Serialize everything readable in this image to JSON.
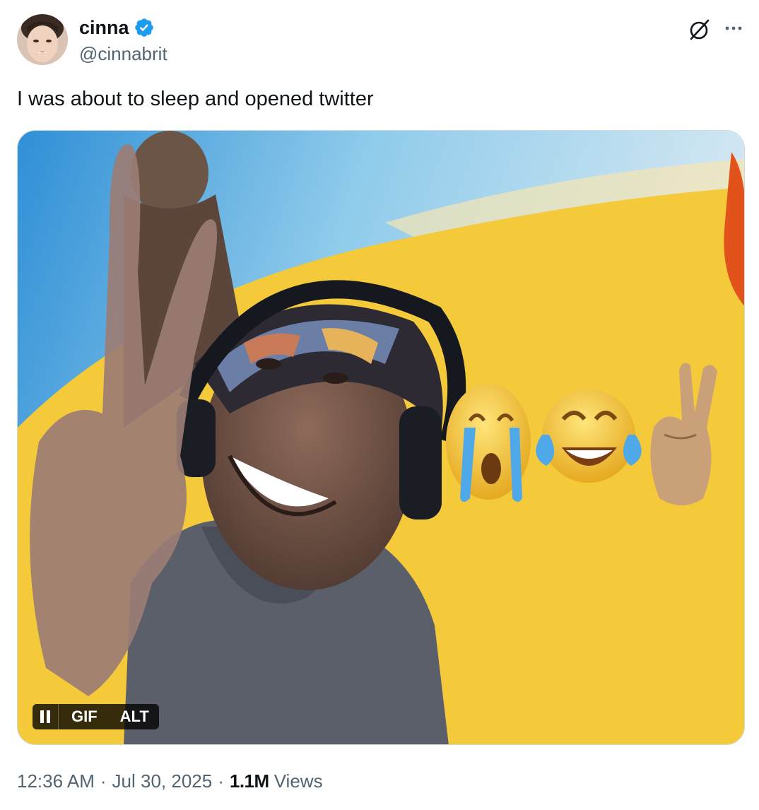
{
  "author": {
    "display_name": "cinna",
    "handle": "@cinnabrit",
    "verified": true
  },
  "icons": {
    "avatar": "avatar",
    "verified": "verified-badge-icon",
    "grok": "grok-icon",
    "more": "more-icon",
    "pause": "pause-icon"
  },
  "tweet": {
    "text": "I was about to sleep and opened twitter"
  },
  "media": {
    "type": "GIF",
    "gif_label": "GIF",
    "alt_label": "ALT"
  },
  "meta": {
    "time": "12:36 AM",
    "date": "Jul 30, 2025",
    "views_count": "1.1M",
    "views_label": "Views",
    "separator": "·"
  },
  "colors": {
    "verified_blue": "#1d9bf0",
    "secondary_text": "#536471",
    "primary_text": "#0f1419"
  }
}
